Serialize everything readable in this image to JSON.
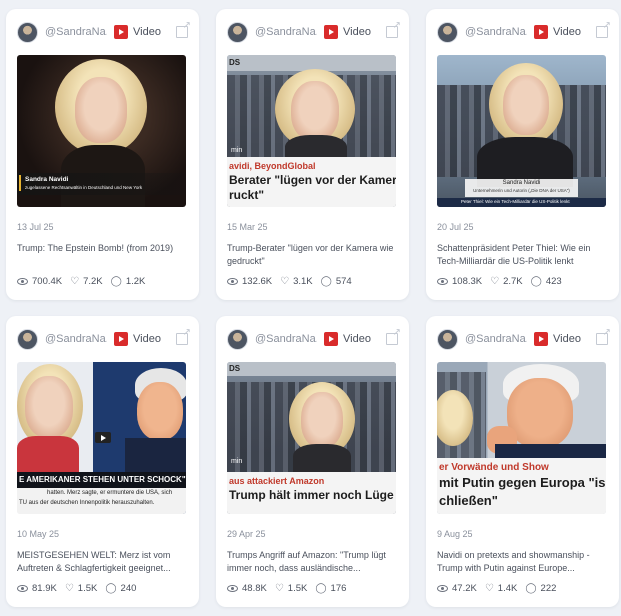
{
  "cards": [
    {
      "handle": "@SandraNa...",
      "badge": "Video",
      "date": "13 Jul 25",
      "title": "Trump: The Epstein Bomb! (from 2019)",
      "views": "700.4K",
      "likes": "7.2K",
      "comments": "1.2K",
      "thumb": {
        "name_line": "Sandra Navidi",
        "sub_line": "zugelassene Rechtsanwältin in Deutschland und New York"
      }
    },
    {
      "handle": "@SandraNa...",
      "badge": "Video",
      "date": "15 Mar 25",
      "title": "Trump-Berater \"lügen vor der Kamera wie gedruckt\"",
      "views": "132.6K",
      "likes": "3.1K",
      "comments": "574",
      "thumb": {
        "corner": "DS",
        "min": "min",
        "kicker": "avidi, BeyondGlobal",
        "headline1": "Berater \"lügen vor der Kamera",
        "headline2": "ruckt\""
      }
    },
    {
      "handle": "@SandraNa...",
      "badge": "Video",
      "date": "20 Jul 25",
      "title": "Schattenpräsident Peter Thiel: Wie ein Tech-Milliardär die US-Politik lenkt",
      "views": "108.3K",
      "likes": "2.7K",
      "comments": "423",
      "thumb": {
        "name_line": "Sandra Navidi",
        "sub_line": "Unternehmerin und Autorin („Die DNA der USA\")",
        "ticker": "Peter Thiel: Wie ein Tech-Milliardär die US-Politik lenkt"
      }
    },
    {
      "handle": "@SandraNa...",
      "badge": "Video",
      "date": "10 May 25",
      "title": "MEISTGESEHEN WELT: Merz ist vom Auftreten & Schlagfertigkeit geeignet...",
      "views": "81.9K",
      "likes": "1.5K",
      "comments": "240",
      "thumb": {
        "headline1": "E AMERIKANER STEHEN UNTER SCHOCK\" DI",
        "sub1": "hatten. Merz sagte, er ermuntere die USA, sich",
        "sub2": "TU aus der deutschen Innenpolitik herauszuhalten."
      }
    },
    {
      "handle": "@SandraNa...",
      "badge": "Video",
      "date": "29 Apr 25",
      "title": "Trumps Angriff auf Amazon: \"Trump lügt immer noch, dass ausländische...",
      "views": "48.8K",
      "likes": "1.5K",
      "comments": "176",
      "thumb": {
        "corner": "DS",
        "min": "min",
        "kicker": "aus attackiert Amazon",
        "headline1": "Trump hält immer noch Lüge auf"
      }
    },
    {
      "handle": "@SandraNa...",
      "badge": "Video",
      "date": "9 Aug 25",
      "title": "Navidi on pretexts and showmanship - Trump with Putin against Europe...",
      "views": "47.2K",
      "likes": "1.4K",
      "comments": "222",
      "thumb": {
        "kicker": "er Vorwände und Show",
        "headline1": "mit Putin gegen Europa \"is",
        "headline2": "chließen\""
      }
    }
  ],
  "colors": {
    "background": "#eef1f6",
    "card": "#ffffff",
    "youtube_red": "#d92b2b",
    "headline_red": "#c0392b"
  },
  "icons": {
    "views": "eye-icon",
    "likes": "heart-icon",
    "comments": "comment-icon",
    "source": "youtube-icon",
    "open": "external-link-icon"
  }
}
